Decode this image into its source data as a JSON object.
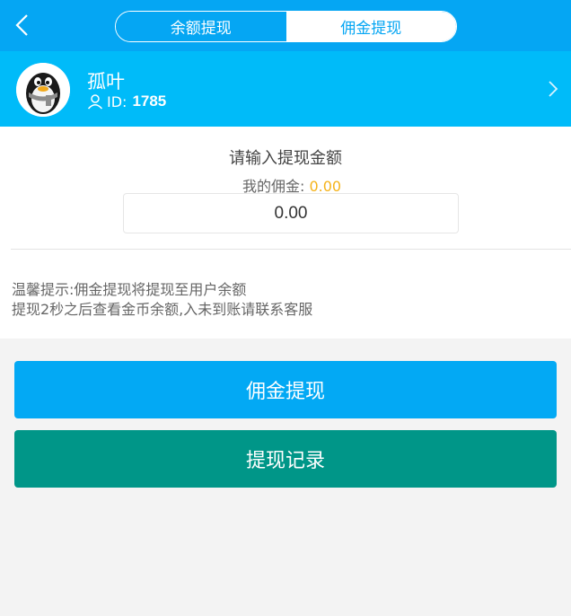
{
  "header": {
    "tabs": [
      {
        "label": "余额提现",
        "active": false
      },
      {
        "label": "佣金提现",
        "active": true
      }
    ],
    "icons": {
      "back": "chevron-left-icon"
    }
  },
  "user": {
    "name": "孤叶",
    "id_label": "ID:",
    "id_value": "1785",
    "avatar_text": "头像"
  },
  "form": {
    "prompt": "请输入提现金额",
    "balance_label": "我的佣金:",
    "balance_value": "0.00",
    "amount_value": "0.00"
  },
  "tips": {
    "line1": "温馨提示:佣金提现将提现至用户余额",
    "line2": "提现2秒之后查看金币余额,入未到账请联系客服"
  },
  "buttons": {
    "withdraw": "佣金提现",
    "records": "提现记录"
  },
  "colors": {
    "header_bg": "#05a6f3",
    "user_bar_bg": "#00bbf9",
    "balance_value": "#f5b31a",
    "withdraw_btn": "#03a9f4",
    "records_btn": "#009688"
  }
}
